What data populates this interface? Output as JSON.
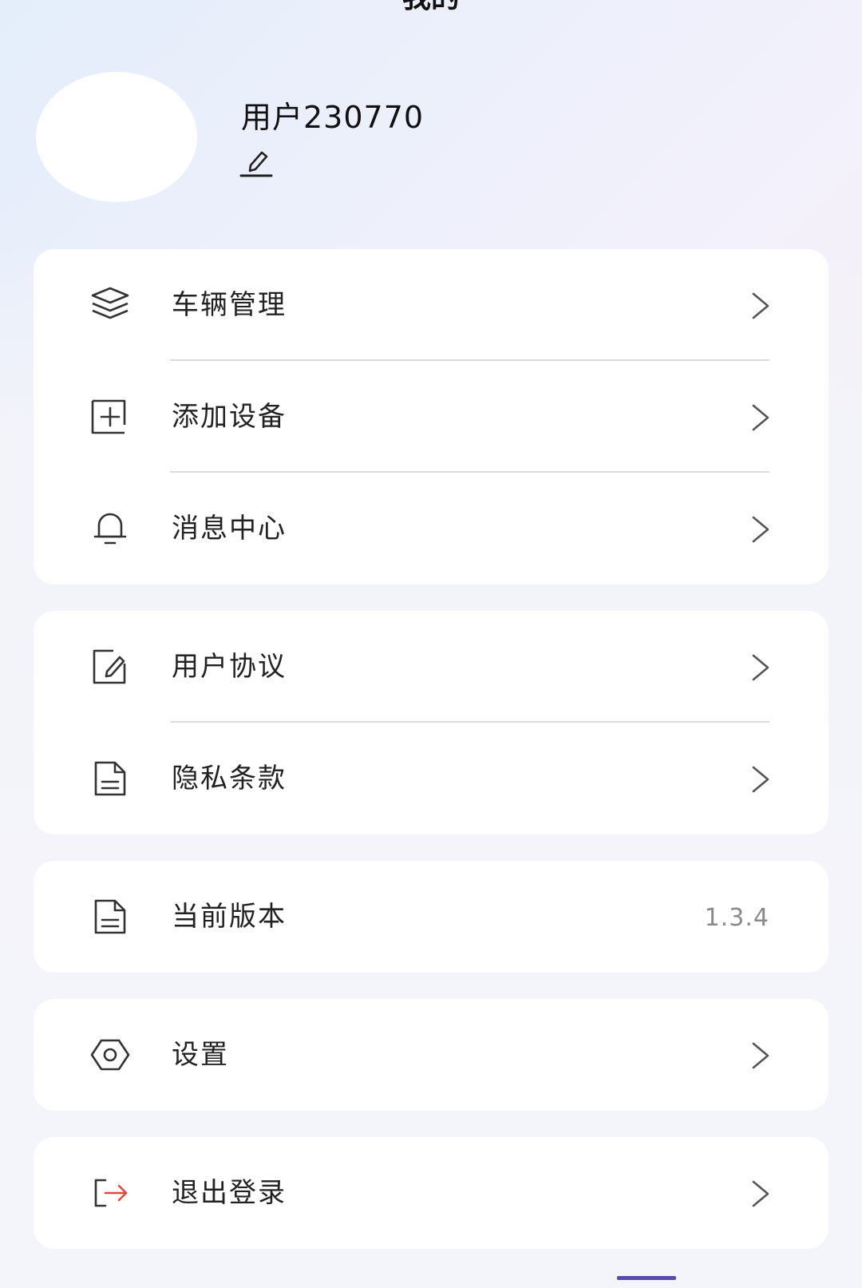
{
  "header": {
    "title": "我的"
  },
  "profile": {
    "username": "用户230770",
    "edit_icon": "pencil-icon"
  },
  "menu_group_1": {
    "items": [
      {
        "label": "车辆管理",
        "icon": "layers-icon"
      },
      {
        "label": "添加设备",
        "icon": "add-square-icon"
      },
      {
        "label": "消息中心",
        "icon": "bell-icon"
      }
    ]
  },
  "menu_group_2": {
    "items": [
      {
        "label": "用户协议",
        "icon": "edit-document-icon"
      },
      {
        "label": "隐私条款",
        "icon": "document-icon"
      }
    ]
  },
  "version": {
    "label": "当前版本",
    "value": "1.3.4",
    "icon": "document-icon"
  },
  "settings": {
    "label": "设置",
    "icon": "hexagon-gear-icon"
  },
  "logout": {
    "label": "退出登录",
    "icon": "logout-icon",
    "accent_color": "#e5483d"
  }
}
